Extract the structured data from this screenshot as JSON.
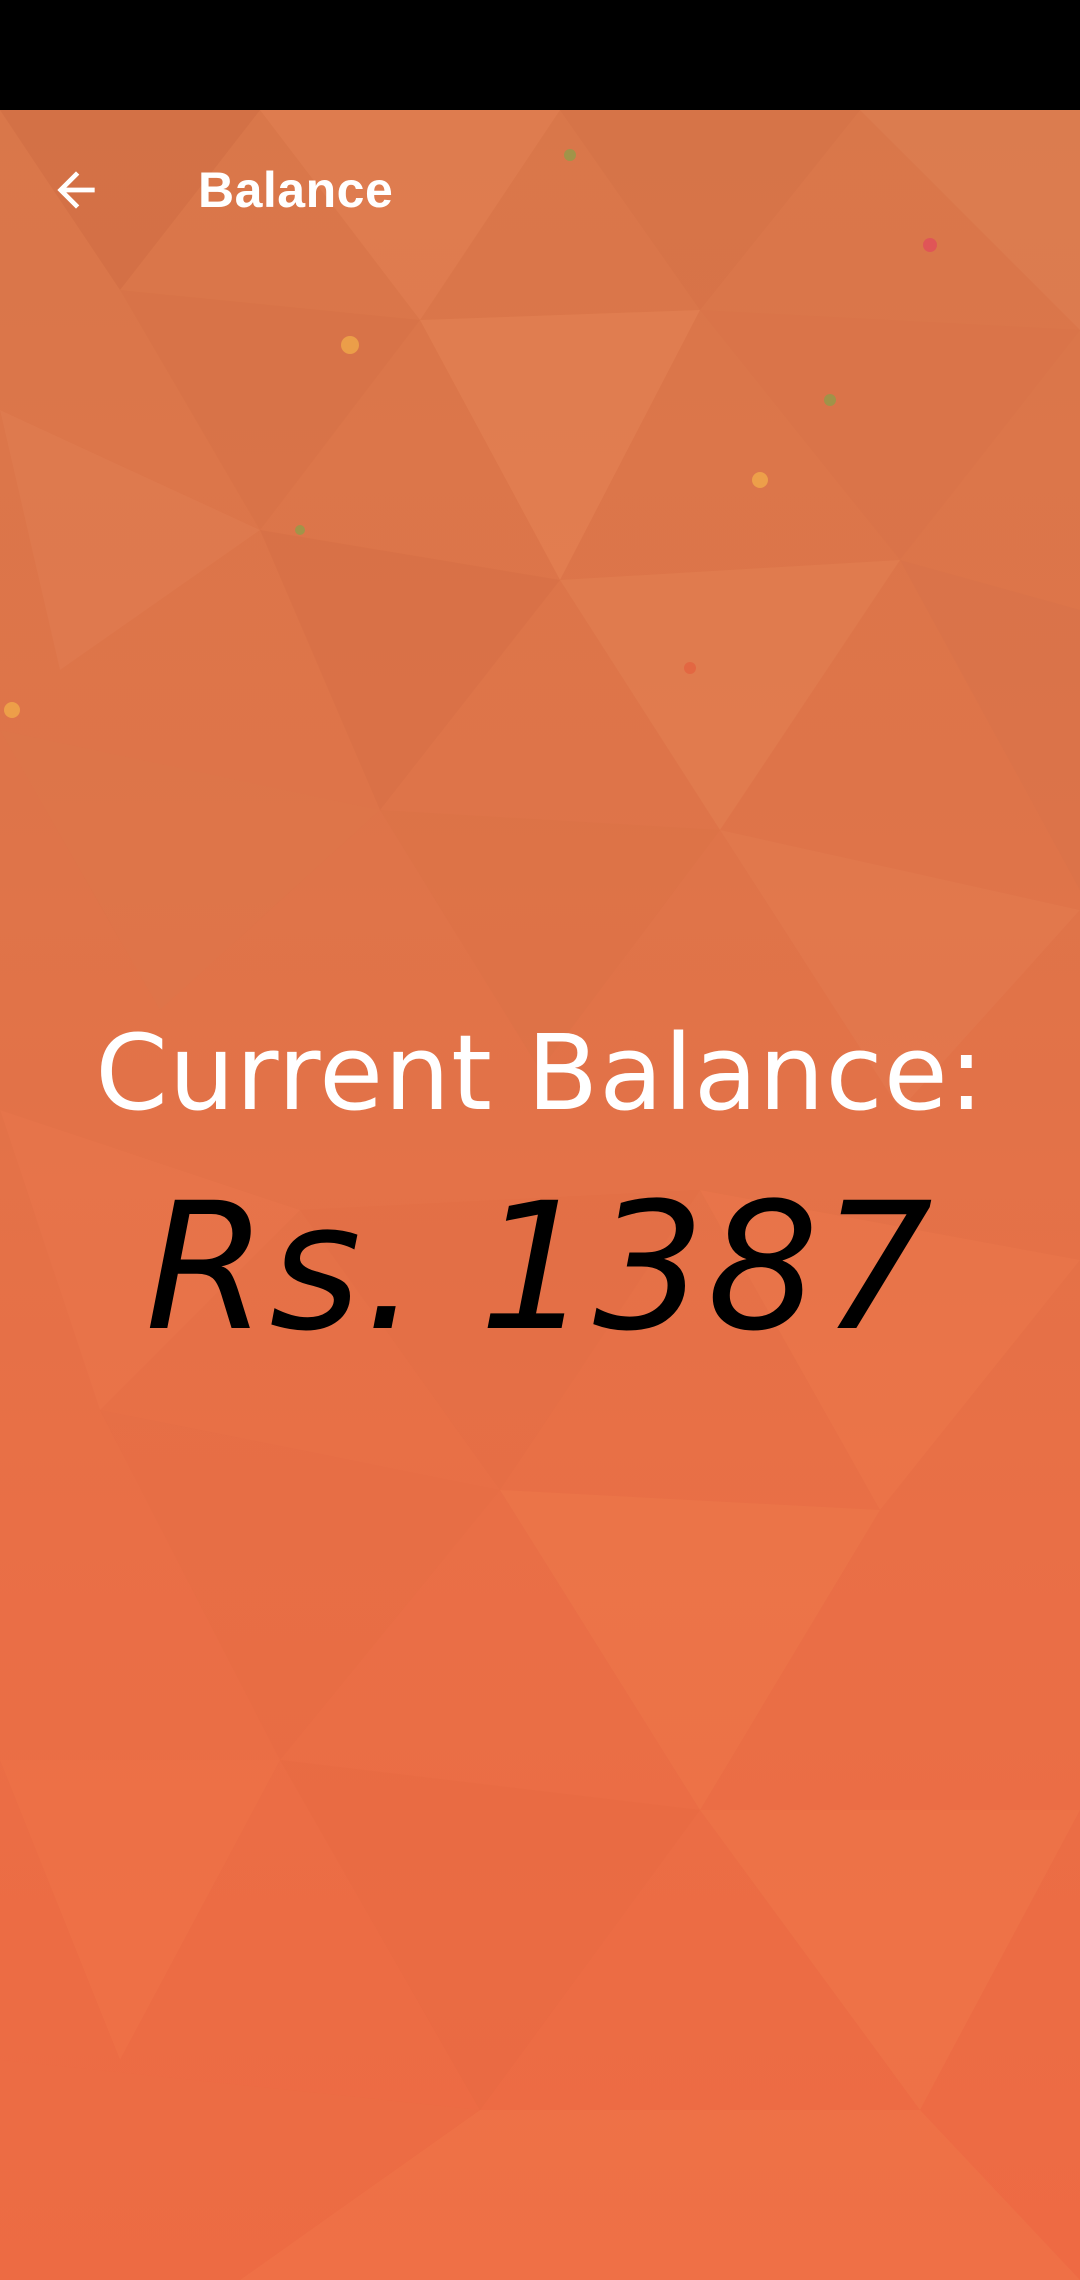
{
  "header": {
    "title": "Balance",
    "back_icon": "arrow-left-icon"
  },
  "balance": {
    "label": "Current Balance:",
    "amount": "Rs. 1387"
  },
  "colors": {
    "background_top": "#d9774a",
    "background_bottom": "#ee6a43",
    "status_bar": "#000000",
    "label_text": "#ffffff",
    "amount_text": "#000000"
  }
}
